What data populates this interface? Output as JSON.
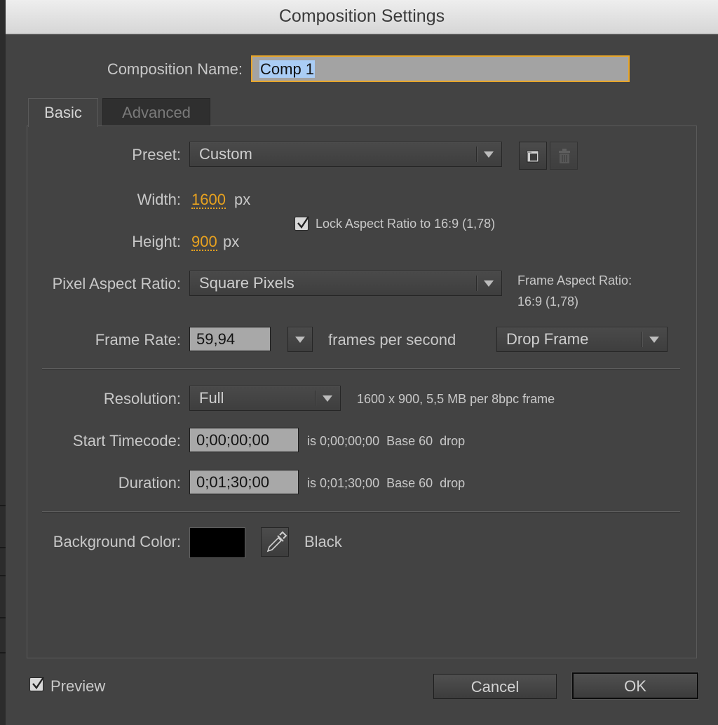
{
  "window": {
    "title": "Composition Settings"
  },
  "composition_name": {
    "label": "Composition Name:",
    "value": "Comp 1"
  },
  "tabs": [
    {
      "label": "Basic",
      "active": true
    },
    {
      "label": "Advanced",
      "active": false
    }
  ],
  "preset": {
    "label": "Preset:",
    "value": "Custom",
    "icons": [
      "save-preset-icon",
      "trash-icon"
    ]
  },
  "width": {
    "label": "Width:",
    "value": "1600",
    "unit": "px"
  },
  "height": {
    "label": "Height:",
    "value": "900",
    "unit": "px"
  },
  "lock_aspect": {
    "label": "Lock Aspect Ratio to 16:9 (1,78)",
    "checked": true
  },
  "pixel_aspect": {
    "label": "Pixel Aspect Ratio:",
    "value": "Square Pixels"
  },
  "frame_aspect": {
    "label": "Frame Aspect Ratio:",
    "value": "16:9 (1,78)"
  },
  "frame_rate": {
    "label": "Frame Rate:",
    "value": "59,94",
    "suffix": "frames per second",
    "mode": "Drop Frame"
  },
  "resolution": {
    "label": "Resolution:",
    "value": "Full",
    "info": "1600 x 900, 5,5 MB per 8bpc frame"
  },
  "start_timecode": {
    "label": "Start Timecode:",
    "value": "0;00;00;00",
    "info": "is 0;00;00;00  Base 60  drop"
  },
  "duration": {
    "label": "Duration:",
    "value": "0;01;30;00",
    "info": "is 0;01;30;00  Base 60  drop"
  },
  "background": {
    "label": "Background Color:",
    "color": "#000000",
    "name": "Black",
    "icon": "eyedropper-icon"
  },
  "preview": {
    "label": "Preview",
    "checked": true
  },
  "buttons": {
    "cancel": "Cancel",
    "ok": "OK"
  },
  "colors": {
    "accent": "#e8a21f",
    "focus_border": "#e7a52a",
    "selection": "#aacdf5"
  }
}
